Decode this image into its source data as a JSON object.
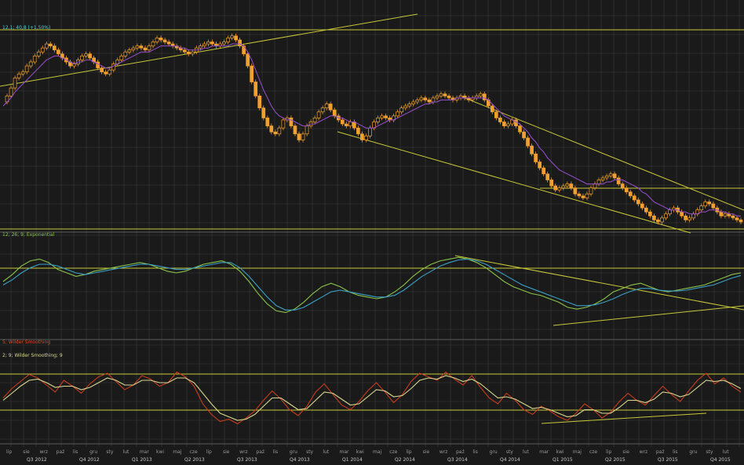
{
  "colors": {
    "background": "#1a1a1a",
    "grid": "#3a3a3a",
    "separator": "#5a5a5a",
    "trendline": "#c8c83a",
    "candle_up": "#f0a030",
    "candle_down": "#f0a030",
    "price_ma": "#9a4fd0",
    "macd_fast": "#8bc34a",
    "macd_slow": "#3aa0c8",
    "stoch_fast": "#c83c1e",
    "stoch_slow": "#d8d890",
    "legend_price": "#4fd0e0",
    "legend_macd": "#8bc34a",
    "legend_stoch1": "#e04a2a",
    "legend_stoch2": "#d8d890"
  },
  "legends": {
    "price": "12,1; 40,8 (+1,50%)",
    "macd": "12; 26; 9; Exponential",
    "stoch1": "5; Wilder Smoothing",
    "stoch2": "2; 9; Wilder Smoothing; 9"
  },
  "chart_data": [
    {
      "type": "candlestick",
      "panel": "price",
      "ylim": [
        0,
        100
      ],
      "grid": true,
      "series": [
        {
          "name": "price",
          "values": [
            60,
            63,
            67,
            72,
            74,
            75,
            78,
            80,
            83,
            85,
            87,
            89,
            88,
            86,
            84,
            82,
            80,
            78,
            79,
            81,
            83,
            84,
            82,
            80,
            77,
            75,
            74,
            76,
            79,
            81,
            83,
            85,
            86,
            87,
            88,
            87,
            86,
            88,
            90,
            92,
            91,
            90,
            89,
            88,
            87,
            86,
            85,
            84,
            85,
            87,
            88,
            89,
            90,
            89,
            88,
            89,
            90,
            92,
            93,
            91,
            88,
            84,
            78,
            70,
            63,
            57,
            52,
            48,
            45,
            44,
            47,
            51,
            52,
            48,
            44,
            41,
            44,
            48,
            50,
            52,
            55,
            57,
            59,
            56,
            53,
            51,
            49,
            48,
            50,
            47,
            44,
            41,
            43,
            47,
            50,
            52,
            53,
            52,
            51,
            53,
            55,
            57,
            58,
            59,
            60,
            61,
            62,
            61,
            60,
            62,
            63,
            64,
            63,
            62,
            61,
            62,
            63,
            62,
            61,
            62,
            63,
            64,
            61,
            58,
            55,
            52,
            50,
            48,
            49,
            51,
            48,
            45,
            42,
            38,
            34,
            30,
            27,
            24,
            21,
            18,
            16,
            17,
            18,
            19,
            17,
            14,
            13,
            12,
            14,
            17,
            19,
            21,
            22,
            23,
            24,
            22,
            19,
            17,
            15,
            13,
            11,
            9,
            7,
            5,
            3,
            1,
            0,
            2,
            4,
            6,
            7,
            5,
            3,
            1,
            2,
            4,
            6,
            8,
            10,
            9,
            7,
            5,
            3,
            4,
            3,
            2,
            1,
            0
          ]
        },
        {
          "name": "ma",
          "values": [
            58,
            60,
            62,
            65,
            67,
            69,
            71,
            73,
            75,
            77,
            79,
            81,
            82,
            83,
            83,
            82,
            81,
            80,
            79,
            80,
            80,
            81,
            81,
            80,
            79,
            78,
            77,
            77,
            78,
            79,
            80,
            81,
            82,
            83,
            84,
            85,
            85,
            85,
            86,
            87,
            88,
            88,
            88,
            88,
            88,
            87,
            87,
            86,
            86,
            86,
            86,
            87,
            87,
            88,
            88,
            88,
            88,
            88,
            89,
            89,
            89,
            88,
            85,
            81,
            76,
            71,
            66,
            62,
            58,
            55,
            53,
            52,
            51,
            51,
            50,
            49,
            48,
            48,
            49,
            49,
            50,
            51,
            52,
            53,
            53,
            52,
            52,
            51,
            50,
            50,
            49,
            48,
            47,
            47,
            47,
            48,
            49,
            50,
            51,
            51,
            52,
            53,
            54,
            55,
            56,
            57,
            58,
            59,
            59,
            60,
            60,
            61,
            61,
            61,
            61,
            62,
            62,
            62,
            62,
            62,
            62,
            62,
            62,
            61,
            59,
            57,
            55,
            53,
            52,
            51,
            50,
            49,
            47,
            45,
            42,
            40,
            37,
            35,
            32,
            30,
            28,
            26,
            25,
            24,
            23,
            22,
            21,
            20,
            19,
            19,
            19,
            19,
            19,
            20,
            20,
            21,
            21,
            21,
            20,
            19,
            18,
            17,
            15,
            14,
            12,
            10,
            9,
            8,
            7,
            6,
            6,
            6,
            5,
            5,
            4,
            4,
            4,
            5,
            5,
            6,
            6,
            6,
            5,
            5,
            4,
            4,
            3,
            3
          ]
        }
      ]
    },
    {
      "type": "line",
      "panel": "macd",
      "title": "12; 26; 9; Exponential",
      "ylim": [
        0,
        100
      ],
      "grid": true,
      "series": [
        {
          "name": "fast",
          "values": [
            60,
            68,
            78,
            84,
            86,
            82,
            74,
            70,
            66,
            68,
            72,
            74,
            76,
            78,
            80,
            82,
            80,
            76,
            72,
            70,
            72,
            76,
            80,
            82,
            84,
            80,
            72,
            60,
            46,
            34,
            26,
            24,
            28,
            36,
            46,
            54,
            58,
            54,
            48,
            44,
            42,
            40,
            42,
            48,
            56,
            66,
            74,
            80,
            84,
            86,
            88,
            86,
            82,
            76,
            68,
            60,
            54,
            50,
            46,
            44,
            40,
            36,
            30,
            28,
            30,
            34,
            40,
            48,
            52,
            56,
            58,
            54,
            50,
            48,
            50,
            52,
            54,
            56,
            60,
            64,
            68,
            70
          ]
        },
        {
          "name": "slow",
          "values": [
            56,
            62,
            70,
            76,
            80,
            80,
            78,
            74,
            70,
            68,
            70,
            72,
            74,
            76,
            78,
            80,
            80,
            78,
            76,
            74,
            74,
            76,
            78,
            80,
            82,
            82,
            76,
            66,
            54,
            42,
            32,
            27,
            27,
            30,
            36,
            42,
            48,
            50,
            48,
            46,
            44,
            42,
            42,
            44,
            50,
            58,
            66,
            72,
            78,
            82,
            85,
            86,
            84,
            80,
            74,
            68,
            62,
            56,
            52,
            48,
            44,
            40,
            36,
            32,
            32,
            33,
            36,
            40,
            45,
            49,
            52,
            52,
            50,
            49,
            49,
            50,
            52,
            54,
            56,
            60,
            64,
            67
          ]
        }
      ]
    },
    {
      "type": "line",
      "panel": "stochastic",
      "ylim": [
        0,
        100
      ],
      "grid": true,
      "series": [
        {
          "name": "fast",
          "values": [
            50,
            66,
            78,
            90,
            84,
            72,
            60,
            80,
            70,
            58,
            74,
            86,
            92,
            78,
            64,
            72,
            88,
            82,
            70,
            76,
            94,
            86,
            70,
            40,
            22,
            10,
            14,
            6,
            16,
            28,
            46,
            62,
            48,
            30,
            20,
            36,
            60,
            74,
            56,
            38,
            30,
            44,
            62,
            76,
            60,
            42,
            56,
            78,
            92,
            86,
            80,
            94,
            82,
            72,
            88,
            68,
            50,
            40,
            58,
            46,
            30,
            22,
            36,
            28,
            18,
            12,
            24,
            40,
            30,
            16,
            26,
            44,
            58,
            46,
            38,
            54,
            70,
            56,
            44,
            62,
            80,
            92,
            74,
            84,
            70,
            60
          ]
        },
        {
          "name": "slow",
          "values": [
            46,
            58,
            70,
            80,
            82,
            76,
            68,
            70,
            70,
            64,
            68,
            76,
            84,
            80,
            72,
            72,
            80,
            80,
            76,
            76,
            84,
            84,
            76,
            58,
            40,
            24,
            18,
            12,
            14,
            22,
            36,
            50,
            50,
            40,
            30,
            32,
            46,
            60,
            58,
            48,
            38,
            40,
            52,
            64,
            62,
            52,
            54,
            66,
            80,
            84,
            82,
            88,
            84,
            78,
            82,
            74,
            62,
            50,
            52,
            48,
            40,
            32,
            34,
            30,
            24,
            18,
            20,
            30,
            30,
            24,
            24,
            34,
            46,
            46,
            42,
            48,
            60,
            58,
            52,
            56,
            68,
            80,
            78,
            80,
            74,
            66
          ]
        }
      ]
    }
  ],
  "quarter_labels": [
    "Q3 2012",
    "Q4 2012",
    "Q1 2013",
    "Q2 2013",
    "Q3 2013",
    "Q4 2013",
    "Q1 2014",
    "Q2 2014",
    "Q3 2014",
    "Q4 2014",
    "Q1 2015",
    "Q2 2015",
    "Q3 2015",
    "Q4 2015"
  ],
  "month_labels": [
    "lip",
    "sie",
    "wrz",
    "paź",
    "lis",
    "gru",
    "sty",
    "lut",
    "mar",
    "kwi",
    "maj",
    "cze",
    "lip",
    "sie",
    "wrz",
    "paź",
    "lis",
    "gru",
    "sty",
    "lut",
    "mar",
    "kwi",
    "maj",
    "cze",
    "lip",
    "sie",
    "wrz",
    "paź",
    "lis",
    "gru",
    "sty",
    "lut",
    "mar",
    "kwi",
    "maj",
    "cze",
    "lip",
    "sie",
    "wrz",
    "paź",
    "lis",
    "gru",
    "sty",
    "lut"
  ]
}
